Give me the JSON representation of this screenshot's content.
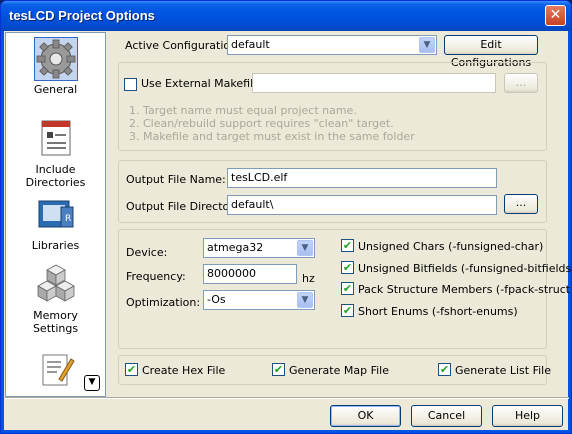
{
  "window": {
    "title": "tesLCD Project Options",
    "close_label": "✕"
  },
  "nav": {
    "items": [
      {
        "label": "General"
      },
      {
        "label": "Include\nDirectories"
      },
      {
        "label": "Libraries"
      },
      {
        "label": "Memory\nSettings"
      },
      {
        "label": ""
      }
    ],
    "scroll_glyph": "▼"
  },
  "config": {
    "label": "Active Configuration",
    "value": "default",
    "edit_button": "Edit Configurations"
  },
  "makefile": {
    "checkbox_label": "Use External Makefile",
    "checked": false,
    "path_value": "",
    "browse_label": "...",
    "notes": [
      "1. Target name must equal project name.",
      "2. Clean/rebuild support requires \"clean\" target.",
      "3. Makefile and target must exist in the same folder"
    ]
  },
  "output": {
    "file_name_label": "Output File Name:",
    "file_name_value": "tesLCD.elf",
    "dir_label": "Output File Directory:",
    "dir_value": "default\\",
    "browse_label": "..."
  },
  "device": {
    "device_label": "Device:",
    "device_value": "atmega32",
    "frequency_label": "Frequency:",
    "frequency_value": "8000000",
    "frequency_unit": "hz",
    "optimization_label": "Optimization:",
    "optimization_value": "-Os"
  },
  "options": [
    {
      "label": "Unsigned Chars (-funsigned-char)",
      "checked": true
    },
    {
      "label": "Unsigned Bitfields (-funsigned-bitfields)",
      "checked": true
    },
    {
      "label": "Pack Structure Members (-fpack-struct)",
      "checked": true
    },
    {
      "label": "Short Enums (-fshort-enums)",
      "checked": true
    }
  ],
  "generate": [
    {
      "label": "Create Hex File",
      "checked": true
    },
    {
      "label": "Generate Map File",
      "checked": true
    },
    {
      "label": "Generate List File",
      "checked": true
    }
  ],
  "footer": {
    "ok": "OK",
    "cancel": "Cancel",
    "help": "Help"
  },
  "check_glyph": "✔"
}
